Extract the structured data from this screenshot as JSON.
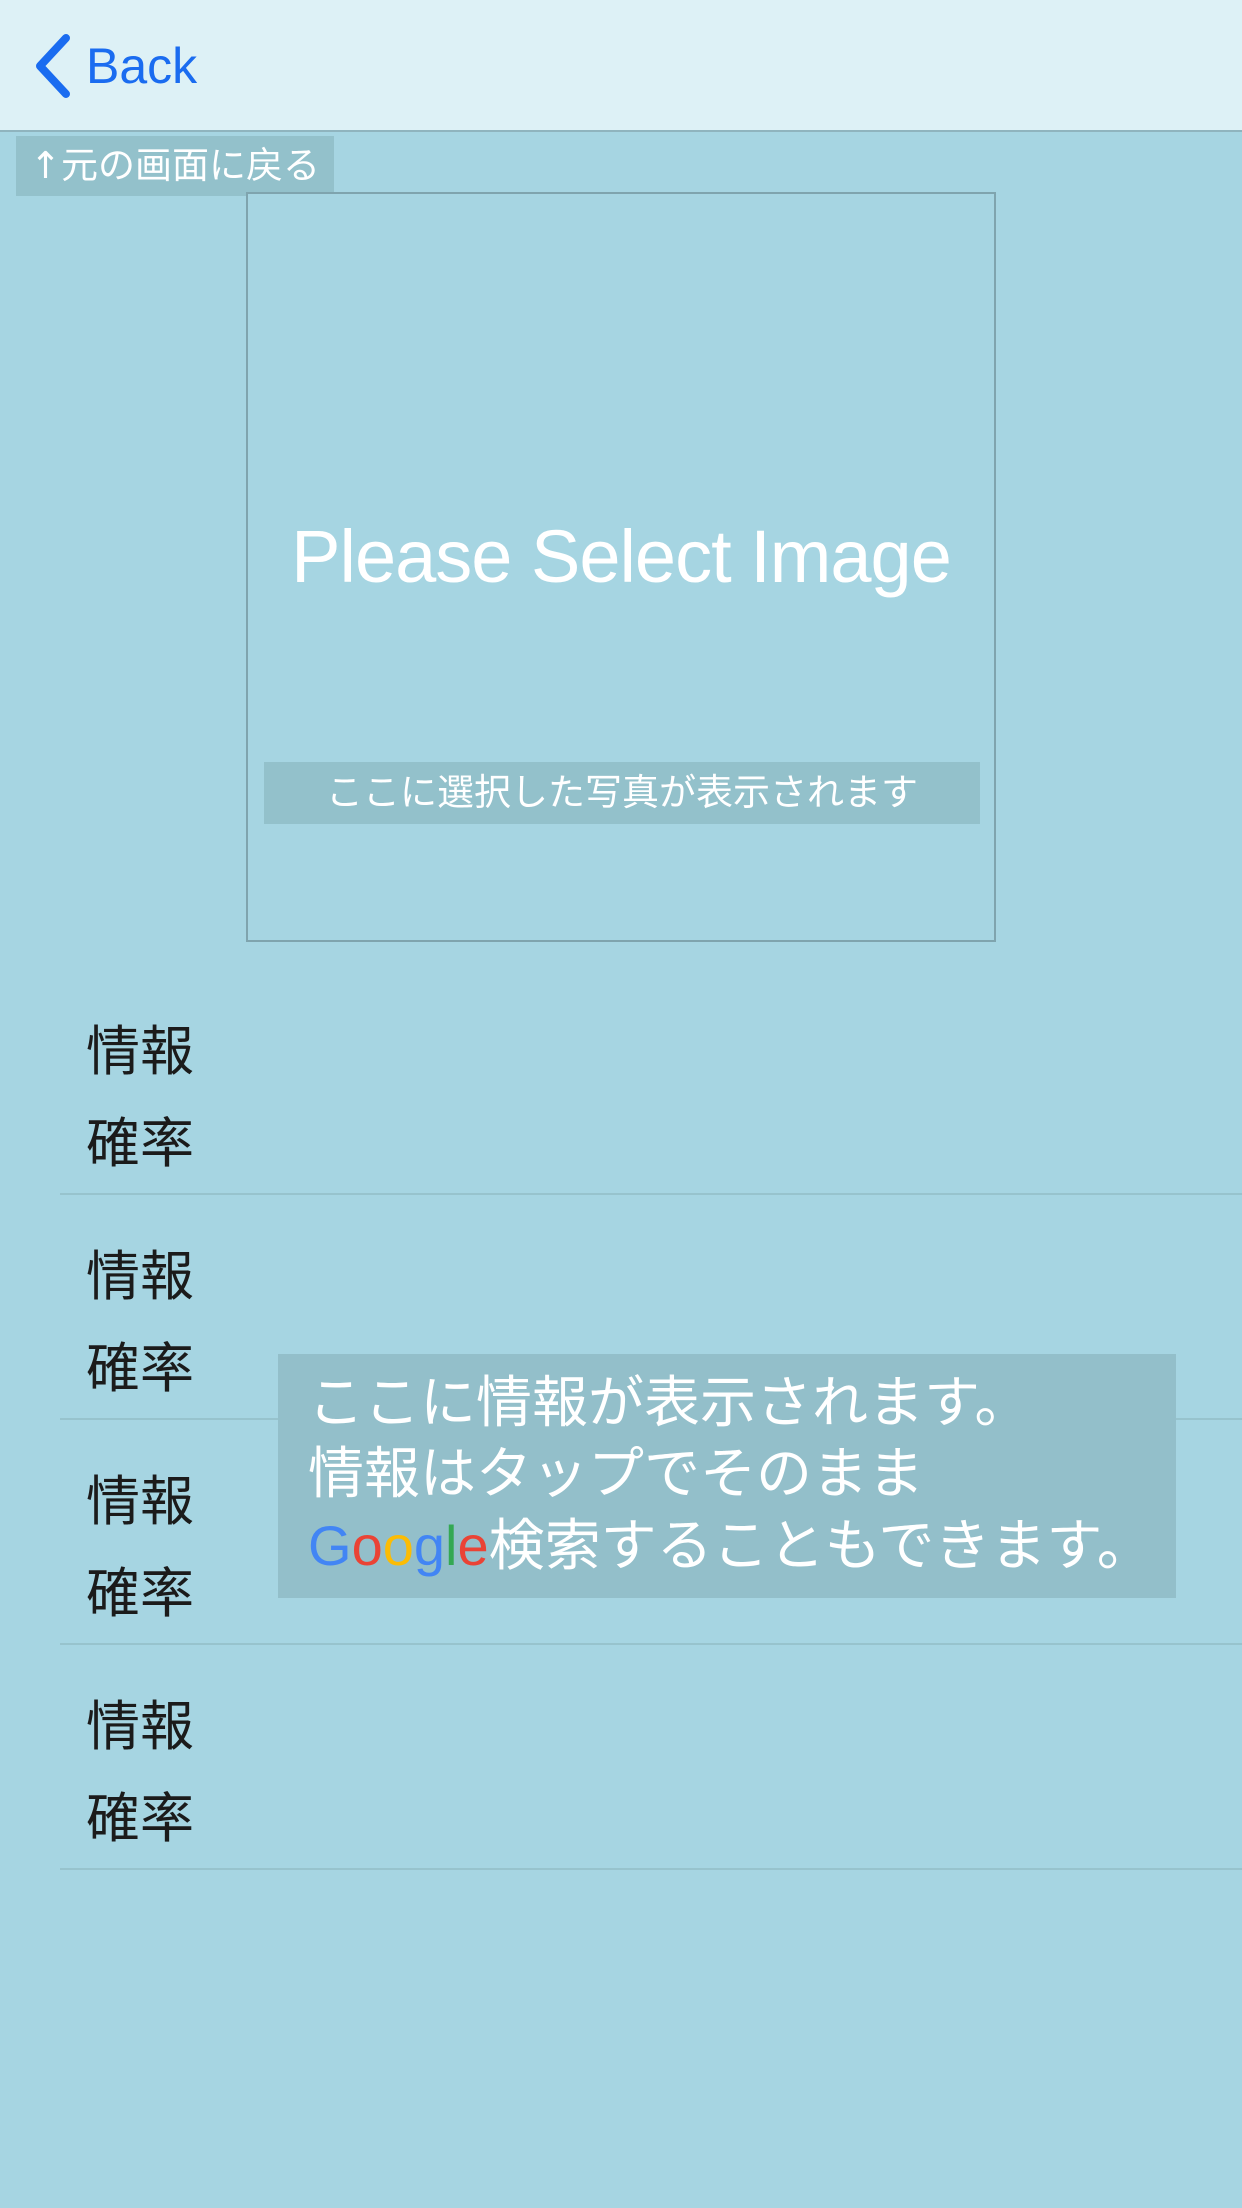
{
  "navbar": {
    "back_label": "Back",
    "accent_color": "#1a6cf0"
  },
  "return_hint": "↑元の画面に戻る",
  "image_area": {
    "placeholder": "Please Select Image",
    "hint": "ここに選択した写真が表示されます"
  },
  "rows": [
    {
      "info_label": "情報",
      "probability_label": "確率"
    },
    {
      "info_label": "情報",
      "probability_label": "確率"
    },
    {
      "info_label": "情報",
      "probability_label": "確率"
    },
    {
      "info_label": "情報",
      "probability_label": "確率"
    }
  ],
  "info_overlay": {
    "line1": "ここに情報が表示されます。",
    "line2": "情報はタップでそのまま",
    "line3_brand": [
      "G",
      "o",
      "o",
      "g",
      "l",
      "e"
    ],
    "line3_rest": "検索することもできます。",
    "brand_colors": [
      "#4285f4",
      "#ea4335",
      "#fbbc05",
      "#4285f4",
      "#34a853",
      "#ea4335"
    ]
  }
}
